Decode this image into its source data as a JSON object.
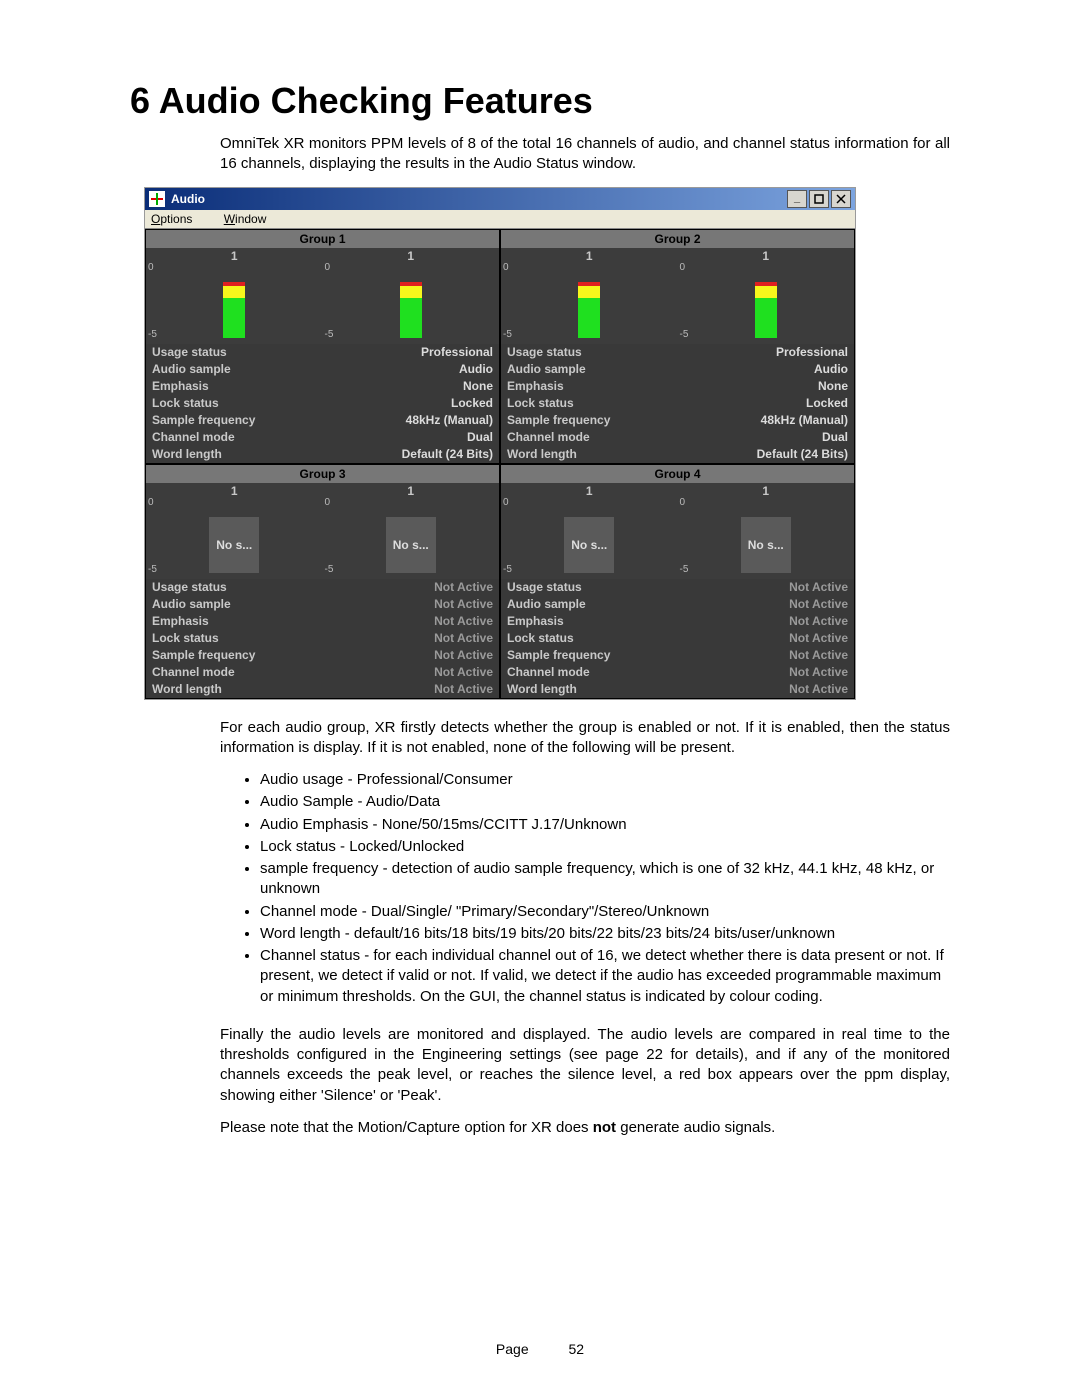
{
  "heading": "6 Audio Checking Features",
  "intro": "OmniTek XR monitors PPM levels of 8 of the total 16 channels of audio, and channel status information for all 16 channels, displaying the results in the Audio Status window.",
  "window": {
    "title": "Audio",
    "menu_options": "Options",
    "menu_window": "Window"
  },
  "scale_top": "0",
  "scale_bottom": "-5",
  "ones_label": "1",
  "nos_label": "No s...",
  "status_labels": {
    "usage": "Usage status",
    "sample": "Audio sample",
    "emphasis": "Emphasis",
    "lock": "Lock status",
    "freq": "Sample frequency",
    "mode": "Channel mode",
    "word": "Word length"
  },
  "groups": [
    {
      "name": "Group 1",
      "active": true,
      "values": {
        "usage": "Professional",
        "sample": "Audio",
        "emphasis": "None",
        "lock": "Locked",
        "freq": "48kHz (Manual)",
        "mode": "Dual",
        "word": "Default (24 Bits)"
      }
    },
    {
      "name": "Group 2",
      "active": true,
      "values": {
        "usage": "Professional",
        "sample": "Audio",
        "emphasis": "None",
        "lock": "Locked",
        "freq": "48kHz (Manual)",
        "mode": "Dual",
        "word": "Default (24 Bits)"
      }
    },
    {
      "name": "Group 3",
      "active": false,
      "values": {
        "usage": "Not Active",
        "sample": "Not Active",
        "emphasis": "Not Active",
        "lock": "Not Active",
        "freq": "Not Active",
        "mode": "Not Active",
        "word": "Not Active"
      }
    },
    {
      "name": "Group 4",
      "active": false,
      "values": {
        "usage": "Not Active",
        "sample": "Not Active",
        "emphasis": "Not Active",
        "lock": "Not Active",
        "freq": "Not Active",
        "mode": "Not Active",
        "word": "Not Active"
      }
    }
  ],
  "para2": "For each audio group, XR firstly detects whether the group is enabled or not.  If it is enabled, then the status information is display.  If it is not enabled, none of the following will be present.",
  "bullets": [
    "Audio usage - Professional/Consumer",
    "Audio Sample - Audio/Data",
    "Audio Emphasis - None/50/15ms/CCITT J.17/Unknown",
    "Lock status - Locked/Unlocked",
    "sample frequency - detection of audio sample frequency, which is one of 32 kHz, 44.1 kHz, 48 kHz, or unknown",
    "Channel mode - Dual/Single/ \"Primary/Secondary\"/Stereo/Unknown",
    "Word length  - default/16 bits/18 bits/19 bits/20 bits/22 bits/23 bits/24 bits/user/unknown",
    "Channel status - for each individual channel out of 16, we detect whether there is data present or not.  If present, we detect if valid or not.  If valid, we detect if the audio has exceeded programmable maximum or minimum thresholds.  On the GUI, the channel status is indicated by colour coding."
  ],
  "para3": "Finally the audio levels are monitored and displayed.  The audio levels are compared in real time to the thresholds configured in the Engineering settings (see page 22 for details), and if any of the monitored channels exceeds the peak level, or reaches the silence level, a red box appears over the ppm display, showing either 'Silence' or 'Peak'.",
  "para4a": "Please note that the Motion/Capture option for XR does ",
  "para4bold": "not",
  "para4b": " generate audio signals.",
  "page_label": "Page",
  "page_num": "52"
}
